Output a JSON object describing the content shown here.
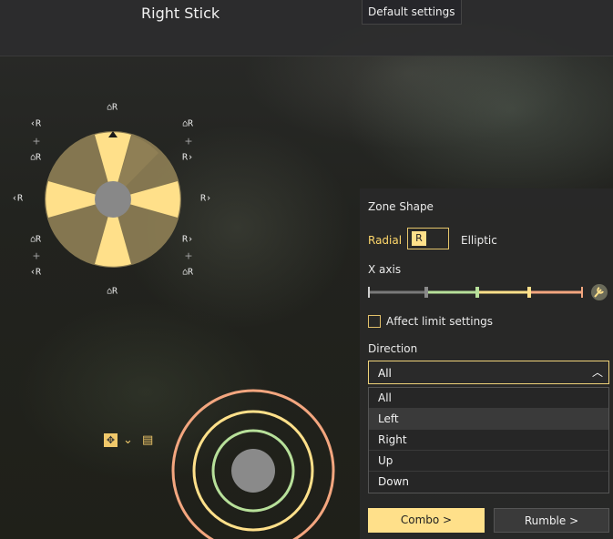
{
  "header": {
    "title": "Right Stick",
    "default_button": "Default settings"
  },
  "stick_labels": {
    "top": "⌂R",
    "bottom": "⌂R",
    "left": "‹R",
    "right": "R›",
    "upper_left_1": "‹R",
    "upper_left_2": "⌂R",
    "upper_right_1": "⌂R",
    "upper_right_2": "R›",
    "lower_left_1": "⌂R",
    "lower_left_2": "‹R",
    "lower_right_1": "R›",
    "lower_right_2": "⌂R",
    "plus": "+"
  },
  "zone_shape": {
    "label": "Zone Shape",
    "radial": "Radial",
    "box_value": "R",
    "elliptic": "Elliptic"
  },
  "axis": {
    "label": "X axis"
  },
  "affect": {
    "label": "Affect limit settings",
    "checked": false
  },
  "direction": {
    "label": "Direction",
    "selected": "All",
    "options": [
      "All",
      "Left",
      "Right",
      "Up",
      "Down"
    ],
    "hovered": "Left"
  },
  "buttons": {
    "combo": "Combo >",
    "rumble": "Rumble >"
  },
  "colors": {
    "accent": "#ffe08a",
    "ring_outer": "#f3a67f",
    "ring_mid": "#ffe08a",
    "ring_inner": "#b7e09a",
    "thumb": "#8a8a8a"
  }
}
